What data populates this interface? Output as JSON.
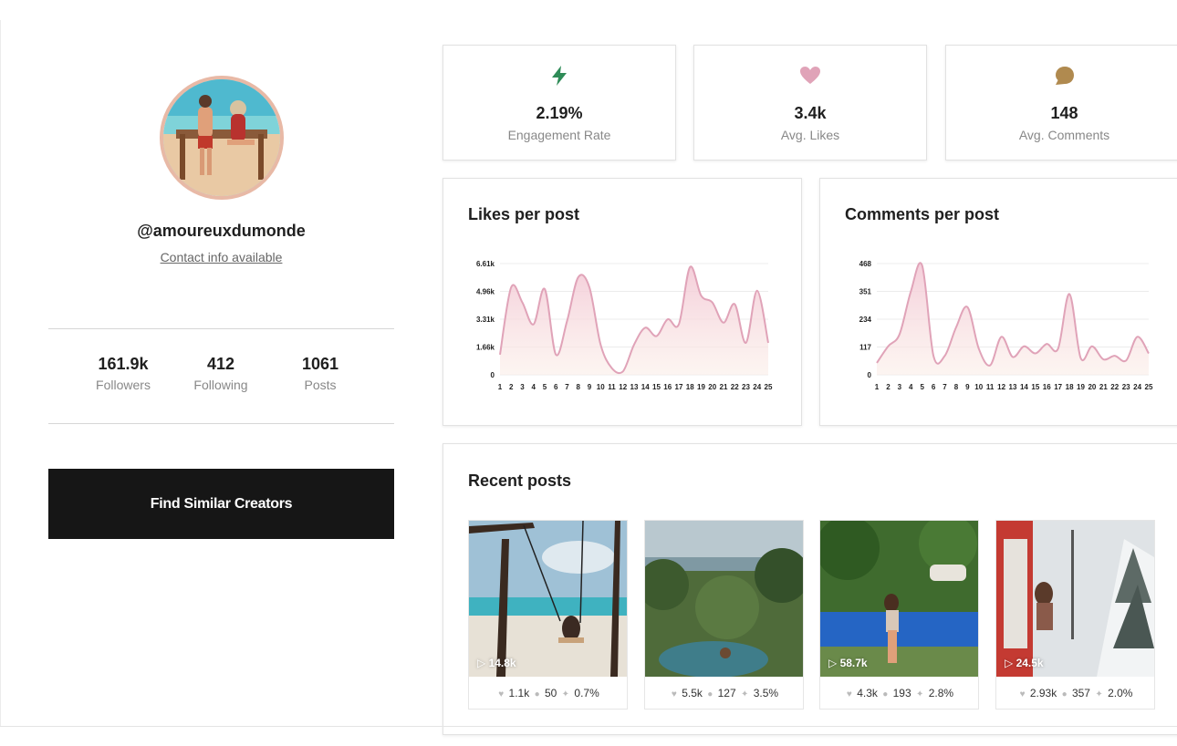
{
  "profile": {
    "handle": "@amoureuxdumonde",
    "contact": "Contact info available",
    "stats": [
      {
        "value": "161.9k",
        "label": "Followers"
      },
      {
        "value": "412",
        "label": "Following"
      },
      {
        "value": "1061",
        "label": "Posts"
      }
    ],
    "button": "Find Similar Creators"
  },
  "metrics": [
    {
      "icon": "lightning-icon",
      "value": "2.19%",
      "label": "Engagement Rate",
      "color": "#2e8b57"
    },
    {
      "icon": "heart-icon",
      "value": "3.4k",
      "label": "Avg. Likes",
      "color": "#e0a3b8"
    },
    {
      "icon": "comment-icon",
      "value": "148",
      "label": "Avg. Comments",
      "color": "#b08a4f"
    }
  ],
  "chart_data": [
    {
      "type": "area",
      "title": "Likes per post",
      "x": [
        1,
        2,
        3,
        4,
        5,
        6,
        7,
        8,
        9,
        10,
        11,
        12,
        13,
        14,
        15,
        16,
        17,
        18,
        19,
        20,
        21,
        22,
        23,
        24,
        25
      ],
      "y_ticks": [
        "0",
        "1.66k",
        "3.31k",
        "4.96k",
        "6.61k"
      ],
      "ylim": [
        0,
        6610
      ],
      "series": [
        {
          "values": [
            1200,
            5200,
            4300,
            3000,
            5100,
            1200,
            3200,
            5800,
            5200,
            1800,
            400,
            200,
            1800,
            2800,
            2300,
            3300,
            3000,
            6400,
            4700,
            4300,
            3100,
            4200,
            1900,
            5000,
            1900
          ]
        }
      ],
      "grid": true
    },
    {
      "type": "area",
      "title": "Comments per post",
      "x": [
        1,
        2,
        3,
        4,
        5,
        6,
        7,
        8,
        9,
        10,
        11,
        12,
        13,
        14,
        15,
        16,
        17,
        18,
        19,
        20,
        21,
        22,
        23,
        24,
        25
      ],
      "y_ticks": [
        "0",
        "117",
        "234",
        "351",
        "468"
      ],
      "ylim": [
        0,
        468
      ],
      "series": [
        {
          "values": [
            50,
            120,
            170,
            350,
            460,
            80,
            80,
            200,
            285,
            110,
            40,
            160,
            75,
            120,
            90,
            130,
            110,
            340,
            70,
            120,
            65,
            80,
            60,
            160,
            90
          ]
        }
      ],
      "grid": true
    }
  ],
  "recent": {
    "title": "Recent posts",
    "posts": [
      {
        "views": "▷ 14.8k",
        "likes": "1.1k",
        "comments": "50",
        "er": "0.7%"
      },
      {
        "views": "",
        "likes": "5.5k",
        "comments": "127",
        "er": "3.5%"
      },
      {
        "views": "▷ 58.7k",
        "likes": "4.3k",
        "comments": "193",
        "er": "2.8%"
      },
      {
        "views": "▷ 24.5k",
        "likes": "2.93k",
        "comments": "357",
        "er": "2.0%"
      }
    ]
  },
  "colors": {
    "chart_line": "#e0a3b8",
    "button_bg": "#161616",
    "avatar_border": "#e8b9a6"
  }
}
